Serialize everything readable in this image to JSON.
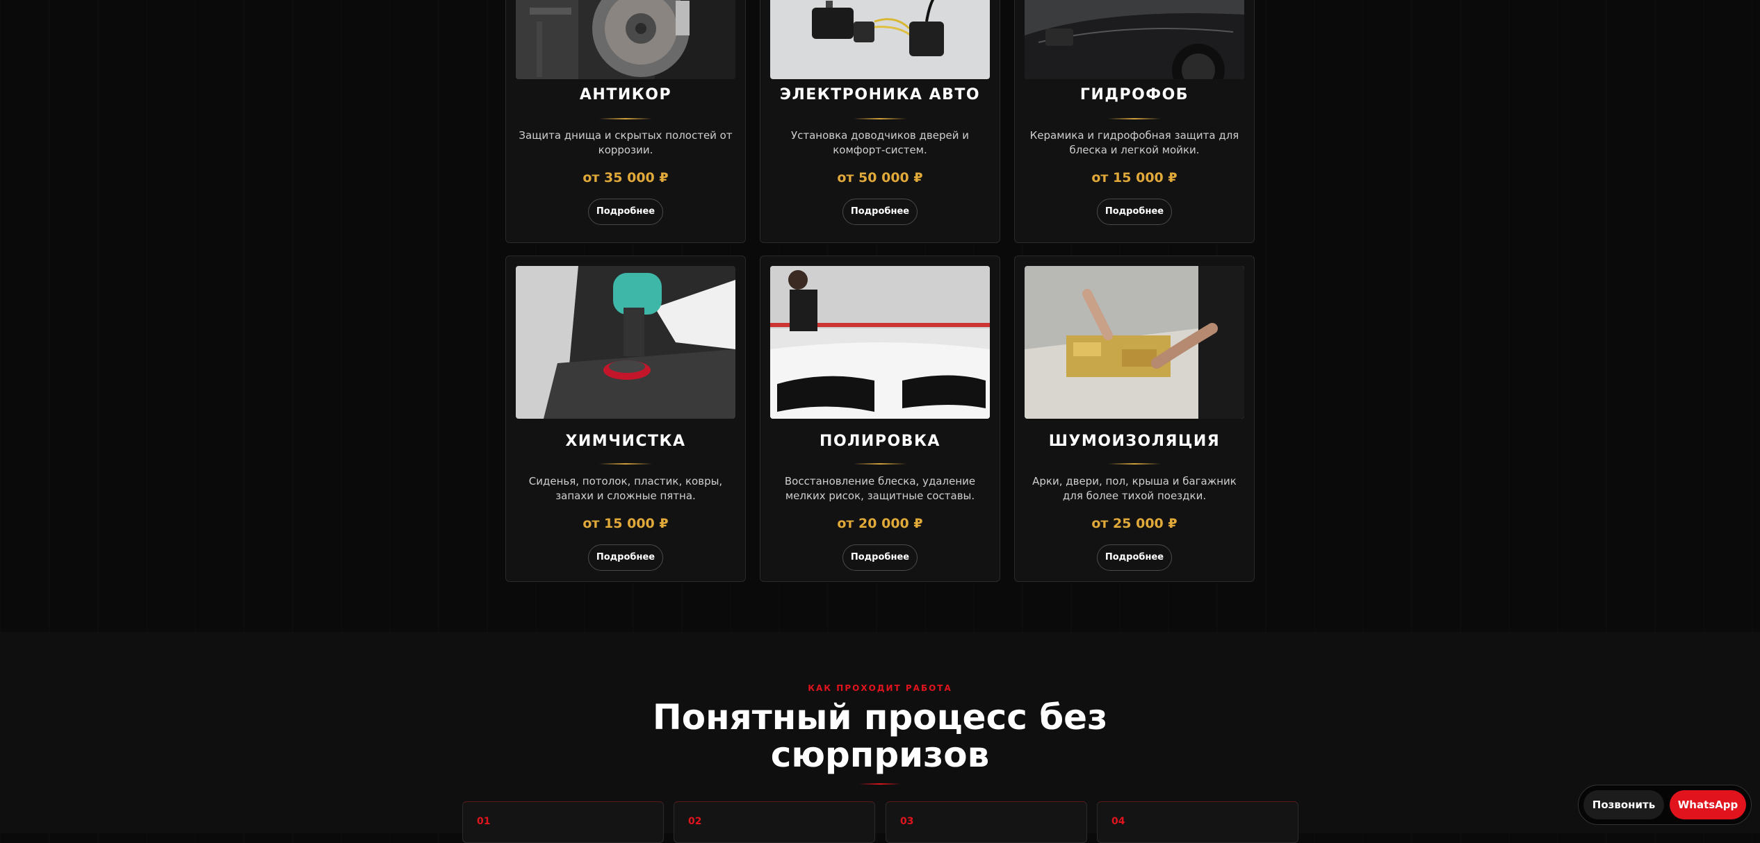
{
  "services": {
    "cards": [
      {
        "title": "АНТИКОР",
        "desc": "Защита днища и скрытых полостей от коррозии.",
        "price": "от 35 000 ₽",
        "button": "Подробнее"
      },
      {
        "title": "ЭЛЕКТРОНИКА АВТО",
        "desc": "Установка доводчиков дверей и комфорт-систем.",
        "price": "от 50 000 ₽",
        "button": "Подробнее"
      },
      {
        "title": "ГИДРОФОБ",
        "desc": "Керамика и гидрофобная защита для блеска и легкой мойки.",
        "price": "от 15 000 ₽",
        "button": "Подробнее"
      },
      {
        "title": "ХИМЧИСТКА",
        "desc": "Сиденья, потолок, пластик, ковры, запахи и сложные пятна.",
        "price": "от 15 000 ₽",
        "button": "Подробнее"
      },
      {
        "title": "ПОЛИРОВКА",
        "desc": "Восстановление блеска, удаление мелких рисок, защитные составы.",
        "price": "от 20 000 ₽",
        "button": "Подробнее"
      },
      {
        "title": "ШУМОИЗОЛЯЦИЯ",
        "desc": "Арки, двери, пол, крыша и багажник для более тихой поездки.",
        "price": "от 25 000 ₽",
        "button": "Подробнее"
      }
    ]
  },
  "process": {
    "eyebrow": "КАК ПРОХОДИТ РАБОТА",
    "title_line1": "Понятный процесс без",
    "title_line2": "сюрпризов",
    "steps": [
      {
        "num": "01"
      },
      {
        "num": "02"
      },
      {
        "num": "03"
      },
      {
        "num": "04"
      }
    ]
  },
  "floating": {
    "call": "Позвонить",
    "whatsapp": "WhatsApp"
  },
  "colors": {
    "accent_red": "#e1141e",
    "price_gold": "#e0a93a",
    "background": "#0a0a0a"
  }
}
